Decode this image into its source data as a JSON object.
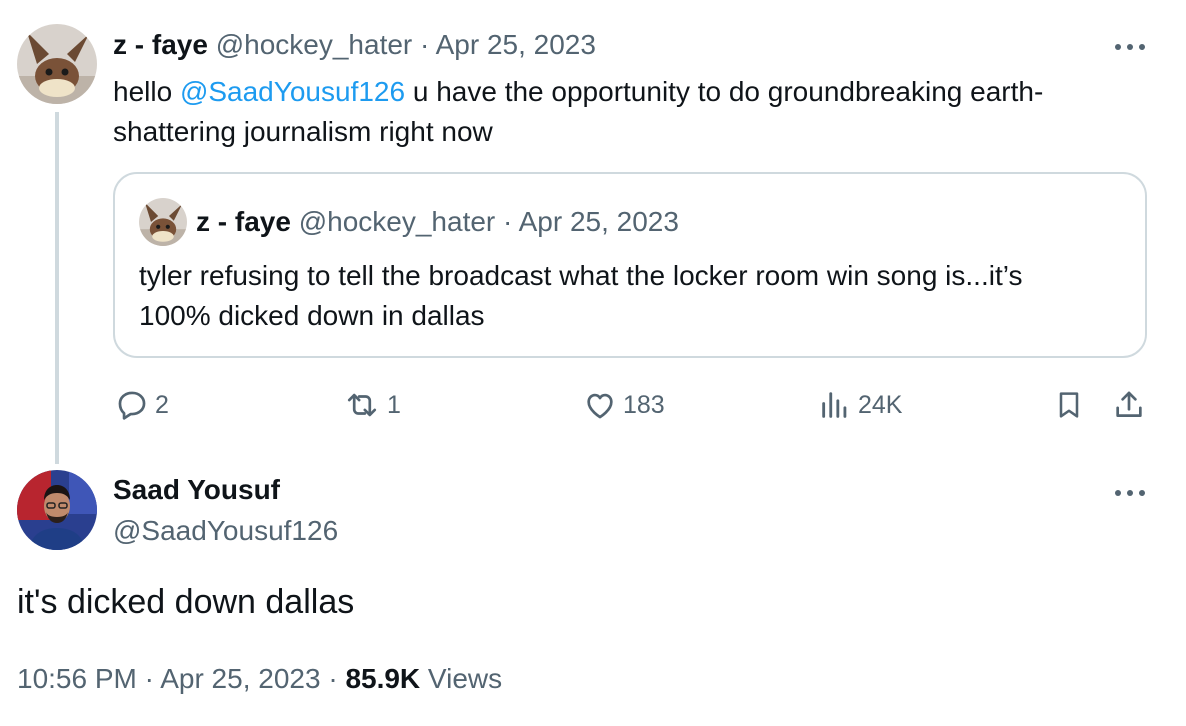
{
  "parent_tweet": {
    "display_name": "z - faye",
    "handle": "@hockey_hater",
    "dot": "·",
    "date": "Apr 25, 2023",
    "text_prefix": "hello ",
    "mention": "@SaadYousuf126",
    "text_line1_rest": " u have the opportunity to do groundbreaking earth-",
    "text_line2": "shattering journalism right now",
    "more_icon": "more-horizontal-icon"
  },
  "quoted_tweet": {
    "display_name": "z - faye",
    "handle": "@hockey_hater",
    "dot": "·",
    "date": "Apr 25, 2023",
    "text_line1": "tyler refusing to tell the broadcast what the locker room win song is...it’s",
    "text_line2": "100% dicked down in dallas"
  },
  "actions": {
    "replies": "2",
    "retweets": "1",
    "likes": "183",
    "views": "24K",
    "icons": [
      "reply-icon",
      "retweet-icon",
      "like-icon",
      "views-icon",
      "bookmark-icon",
      "share-icon"
    ]
  },
  "main_tweet": {
    "display_name": "Saad Yousuf",
    "handle": "@SaadYousuf126",
    "text": "it's dicked down dallas",
    "time": "10:56 PM",
    "dot1": "·",
    "date": "Apr 25, 2023",
    "dot2": "·",
    "views_count": "85.9K",
    "views_label": " Views"
  },
  "colors": {
    "text": "#0f1419",
    "muted": "#536471",
    "link": "#1d9bf0",
    "border": "#cfd9de"
  }
}
